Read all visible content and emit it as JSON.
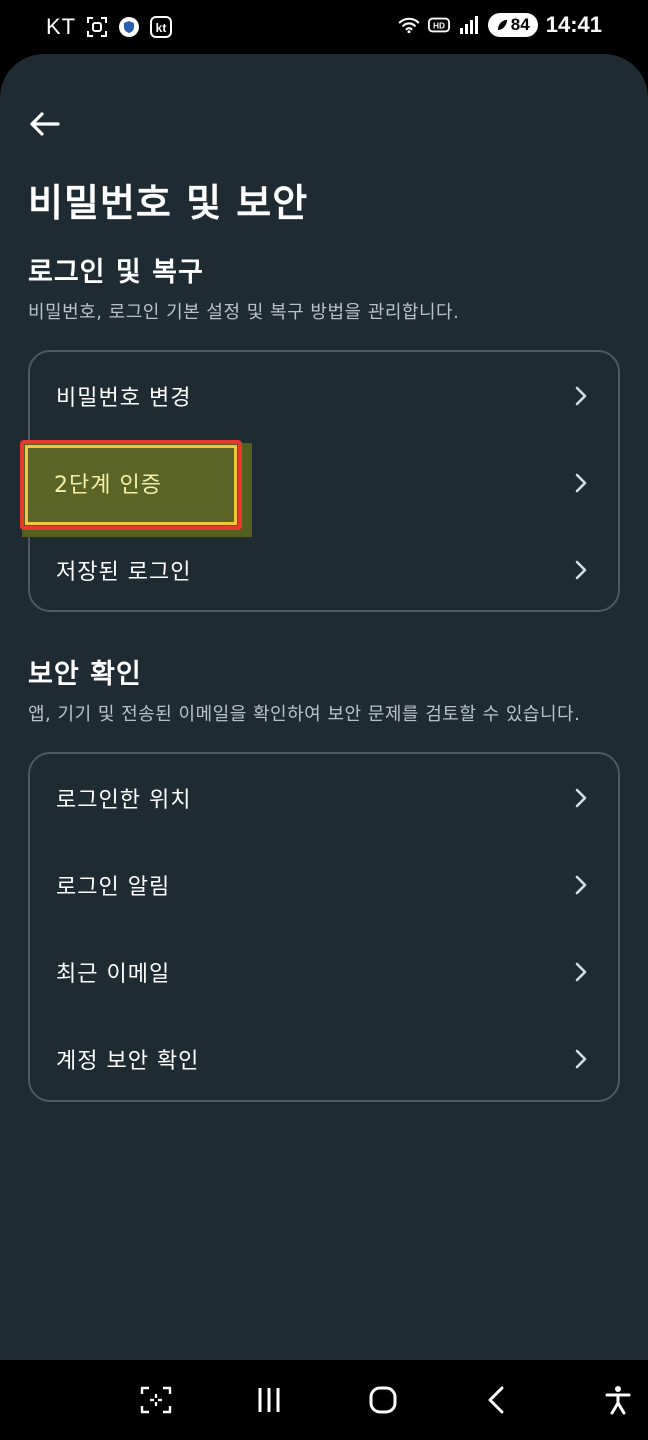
{
  "status_bar": {
    "carrier": "KT",
    "left_icons": [
      "screen-capture-icon",
      "shield-icon",
      "kt-icon"
    ],
    "right_icons": [
      "wifi-icon",
      "hd-icon",
      "signal-icon"
    ],
    "battery": "84",
    "time": "14:41"
  },
  "header": {
    "back_icon": "arrow-left-icon",
    "title": "비밀번호 및 보안"
  },
  "login_section": {
    "title": "로그인 및 복구",
    "description": "비밀번호, 로그인 기본 설정 및 복구 방법을 관리합니다.",
    "items": [
      {
        "label": "비밀번호 변경"
      },
      {
        "label": "2단계 인증",
        "highlighted": true
      },
      {
        "label": "저장된 로그인"
      }
    ]
  },
  "security_section": {
    "title": "보안 확인",
    "description": "앱, 기기 및 전송된 이메일을 확인하여 보안 문제를 검토할 수 있습니다.",
    "items": [
      {
        "label": "로그인한 위치"
      },
      {
        "label": "로그인 알림"
      },
      {
        "label": "최근 이메일"
      },
      {
        "label": "계정 보안 확인"
      }
    ]
  },
  "nav_bar": {
    "icons": [
      "capture-icon",
      "recent-apps-icon",
      "home-icon",
      "back-nav-icon",
      "accessibility-icon"
    ]
  },
  "colors": {
    "background": "#1f2b33",
    "card_border": "#4b5a63",
    "highlight_outer": "#e53a2d",
    "highlight_inner": "#f2c83a",
    "highlight_fill": "#5a6427"
  }
}
